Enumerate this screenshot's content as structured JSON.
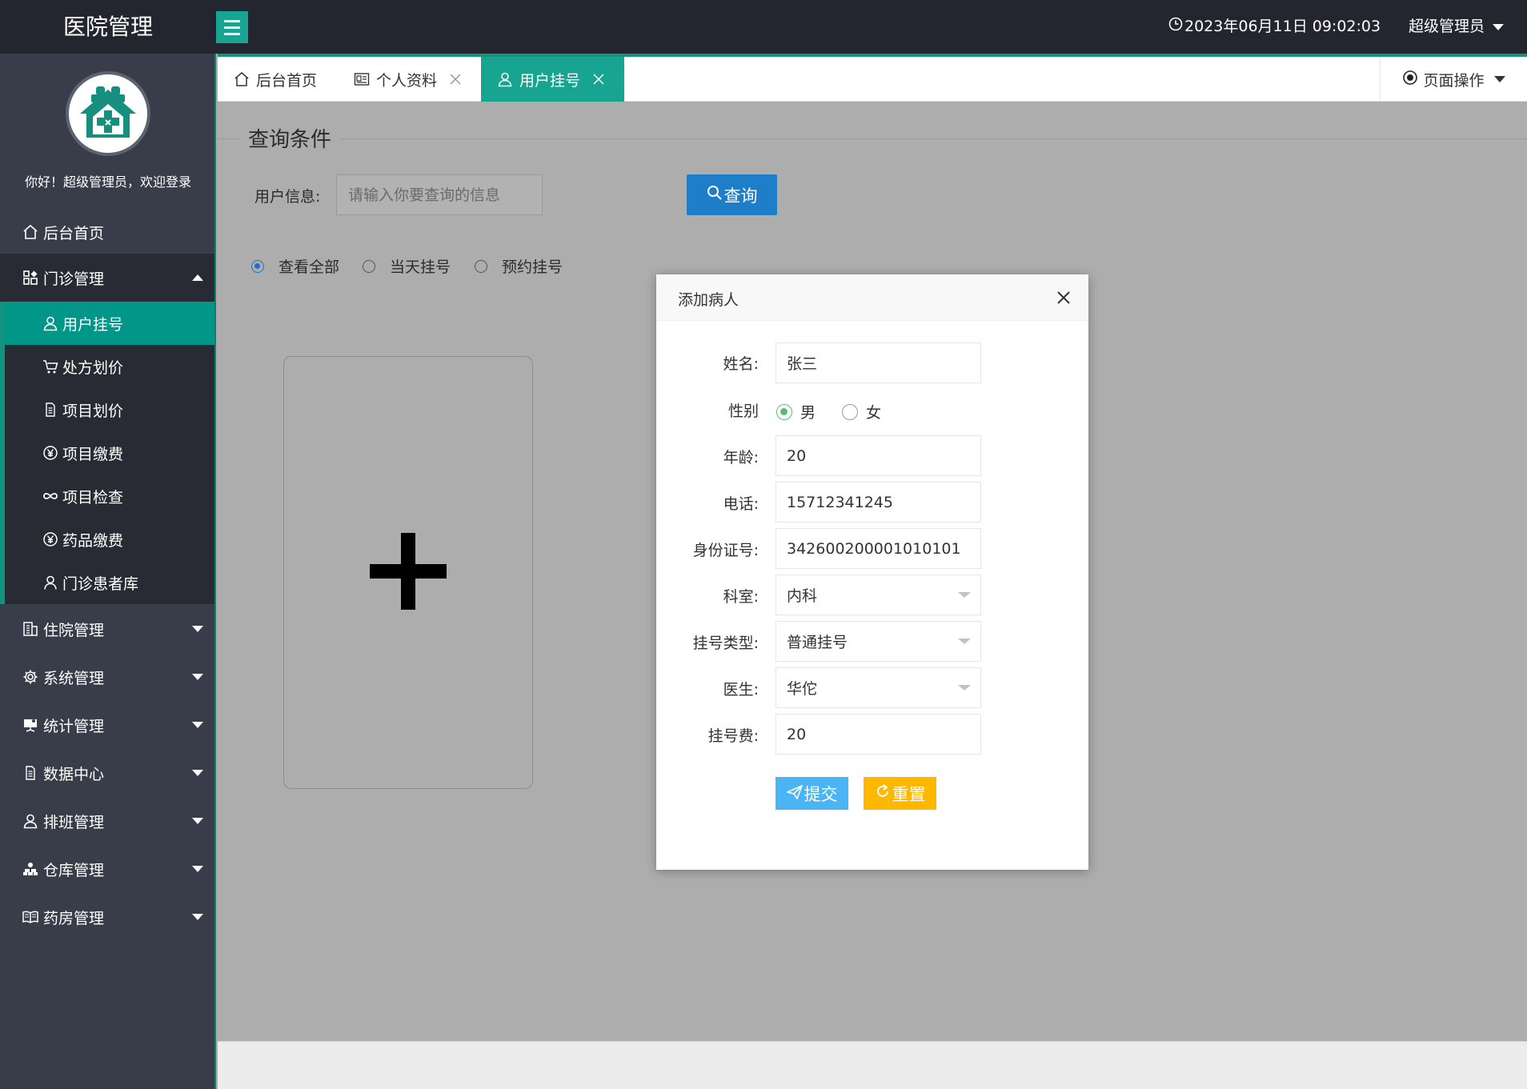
{
  "header": {
    "app_title": "医院管理",
    "datetime": "2023年06月11日 09:02:03",
    "user": "超级管理员"
  },
  "sidebar": {
    "welcome": "你好！超级管理员，欢迎登录",
    "items": {
      "home": "后台首页",
      "outpatient": "门诊管理",
      "inpatient": "住院管理",
      "system": "系统管理",
      "statistics": "统计管理",
      "data": "数据中心",
      "schedule": "排班管理",
      "warehouse": "仓库管理",
      "pharmacy": "药房管理"
    },
    "outpatient_sub": {
      "registration": "用户挂号",
      "prescription": "处方划价",
      "item_pricing": "项目划价",
      "item_payment": "项目缴费",
      "item_check": "项目检查",
      "drug_payment": "药品缴费",
      "patient_db": "门诊患者库"
    }
  },
  "tabs": {
    "home": "后台首页",
    "profile": "个人资料",
    "registration": "用户挂号",
    "page_ops": "页面操作"
  },
  "query": {
    "title": "查询条件",
    "label": "用户信息:",
    "placeholder": "请输入你要查询的信息",
    "button": "查询",
    "filters": {
      "all": "查看全部",
      "today": "当天挂号",
      "reserved": "预约挂号"
    }
  },
  "modal": {
    "title": "添加病人",
    "labels": {
      "name": "姓名:",
      "gender": "性别",
      "age": "年龄:",
      "phone": "电话:",
      "id_card": "身份证号:",
      "department": "科室:",
      "reg_type": "挂号类型:",
      "doctor": "医生:",
      "fee": "挂号费:"
    },
    "values": {
      "name": "张三",
      "gender_male": "男",
      "gender_female": "女",
      "age": "20",
      "phone": "15712341245",
      "id_card": "342600200001010101",
      "department": "内科",
      "reg_type": "普通挂号",
      "doctor": "华佗",
      "fee": "20"
    },
    "buttons": {
      "submit": "提交",
      "reset": "重置"
    }
  },
  "colors": {
    "header_bg": "#23262e",
    "sidebar_bg": "#393d49",
    "accent": "#009688",
    "search_btn": "#1e7fc8",
    "submit_btn": "#4ab5f5",
    "reset_btn": "#ffb800"
  }
}
